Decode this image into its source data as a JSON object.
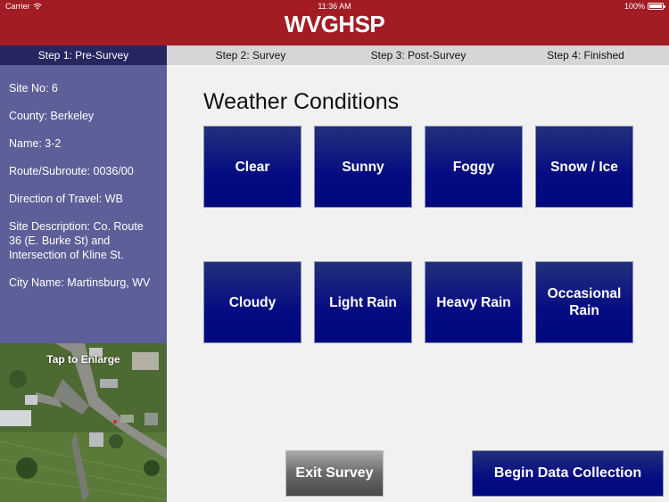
{
  "status_bar": {
    "carrier": "Carrier",
    "time": "11:36 AM",
    "battery": "100%",
    "battery_level": 1.0
  },
  "app": {
    "title": "WVGHSP",
    "colors": {
      "header": "#a11d23",
      "active_step": "#262660",
      "sidebar": "#5d5f98",
      "button_blue": "#00087e",
      "button_gray": "#6a6a6a"
    }
  },
  "steps": [
    {
      "label": "Step 1: Pre-Survey",
      "active": true
    },
    {
      "label": "Step 2: Survey",
      "active": false
    },
    {
      "label": "Step 3: Post-Survey",
      "active": false
    },
    {
      "label": "Step 4: Finished",
      "active": false
    }
  ],
  "site_info": {
    "site_no": "Site No: 6",
    "county": "County: Berkeley",
    "name": "Name: 3-2",
    "route": "Route/Subroute: 0036/00",
    "direction": "Direction of Travel: WB",
    "description": "Site Description: Co. Route 36 (E. Burke St) and Intersection of Kline St.",
    "city": "City Name: Martinsburg, WV"
  },
  "map": {
    "label": "Tap to Enlarge"
  },
  "weather": {
    "title": "Weather Conditions",
    "options": [
      "Clear",
      "Sunny",
      "Foggy",
      "Snow / Ice",
      "Cloudy",
      "Light Rain",
      "Heavy Rain",
      "Occasional Rain"
    ]
  },
  "actions": {
    "exit": "Exit Survey",
    "begin": "Begin Data Collection"
  }
}
